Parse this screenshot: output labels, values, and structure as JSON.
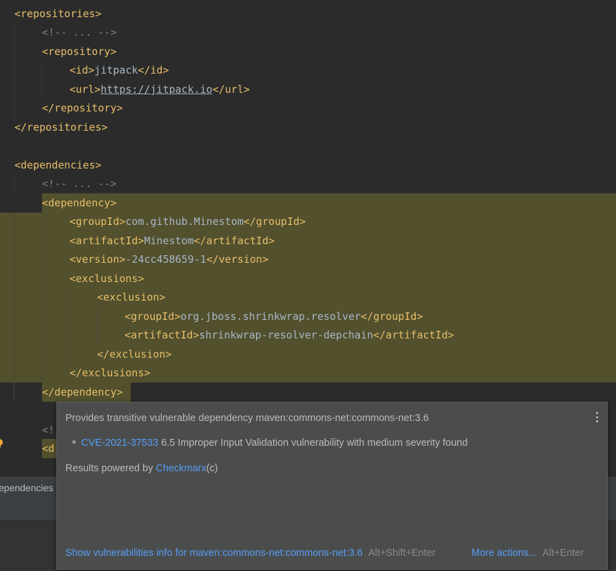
{
  "code": {
    "repositories_open": "<repositories>",
    "repositories_comment": "<!-- ... -->",
    "repository_open": "<repository>",
    "id_open": "<id>",
    "id_value": "jitpack",
    "id_close": "</id>",
    "url_open": "<url>",
    "url_value": "https://jitpack.io",
    "url_close": "</url>",
    "repository_close": "</repository>",
    "repositories_close": "</repositories>",
    "dependencies_open": "<dependencies>",
    "dependencies_comment": "<!-- ... -->",
    "dependency_open": "<dependency>",
    "groupId_open": "<groupId>",
    "groupId_value": "com.github.Minestom",
    "groupId_close": "</groupId>",
    "artifactId_open": "<artifactId>",
    "artifactId_value": "Minestom",
    "artifactId_close": "</artifactId>",
    "version_open": "<version>",
    "version_value": "-24cc458659-1",
    "version_close": "</version>",
    "exclusions_open": "<exclusions>",
    "exclusion_open": "<exclusion>",
    "ex_groupId_open": "<groupId>",
    "ex_groupId_value": "org.jboss.shrinkwrap.resolver",
    "ex_groupId_close": "</groupId>",
    "ex_artifactId_open": "<artifactId>",
    "ex_artifactId_value": "shrinkwrap-resolver-depchain",
    "ex_artifactId_close": "</artifactId>",
    "exclusion_close": "</exclusion>",
    "exclusions_close": "</exclusions>",
    "dependency_close": "</dependency>",
    "partial_comment": "<!",
    "partial_tag": "<d"
  },
  "status_bar": {
    "breadcrumb": "ependencies"
  },
  "popup": {
    "title": "Provides transitive vulnerable dependency maven:commons-net:commons-net:3.6",
    "cve_id": "CVE-2021-37533",
    "cve_description": " 6.5 Improper Input Validation vulnerability with medium severity found",
    "powered_prefix": "Results powered by ",
    "powered_link": "Checkmarx",
    "powered_suffix": "(c)",
    "show_info_link": "Show vulnerabilities info for maven:commons-net:commons-net:3.6",
    "show_info_shortcut": "Alt+Shift+Enter",
    "more_actions_link": "More actions...",
    "more_actions_shortcut": "Alt+Enter"
  },
  "colors": {
    "editor_bg": "#2b2b2b",
    "tag": "#e8bf6a",
    "text": "#a9b7c6",
    "comment": "#808080",
    "highlight": "#52502d",
    "popup_bg": "#4b4d4d",
    "link": "#589df6"
  },
  "icons": {
    "gutter": "lightbulb-warning-icon",
    "popup_menu": "more-vertical-icon"
  }
}
